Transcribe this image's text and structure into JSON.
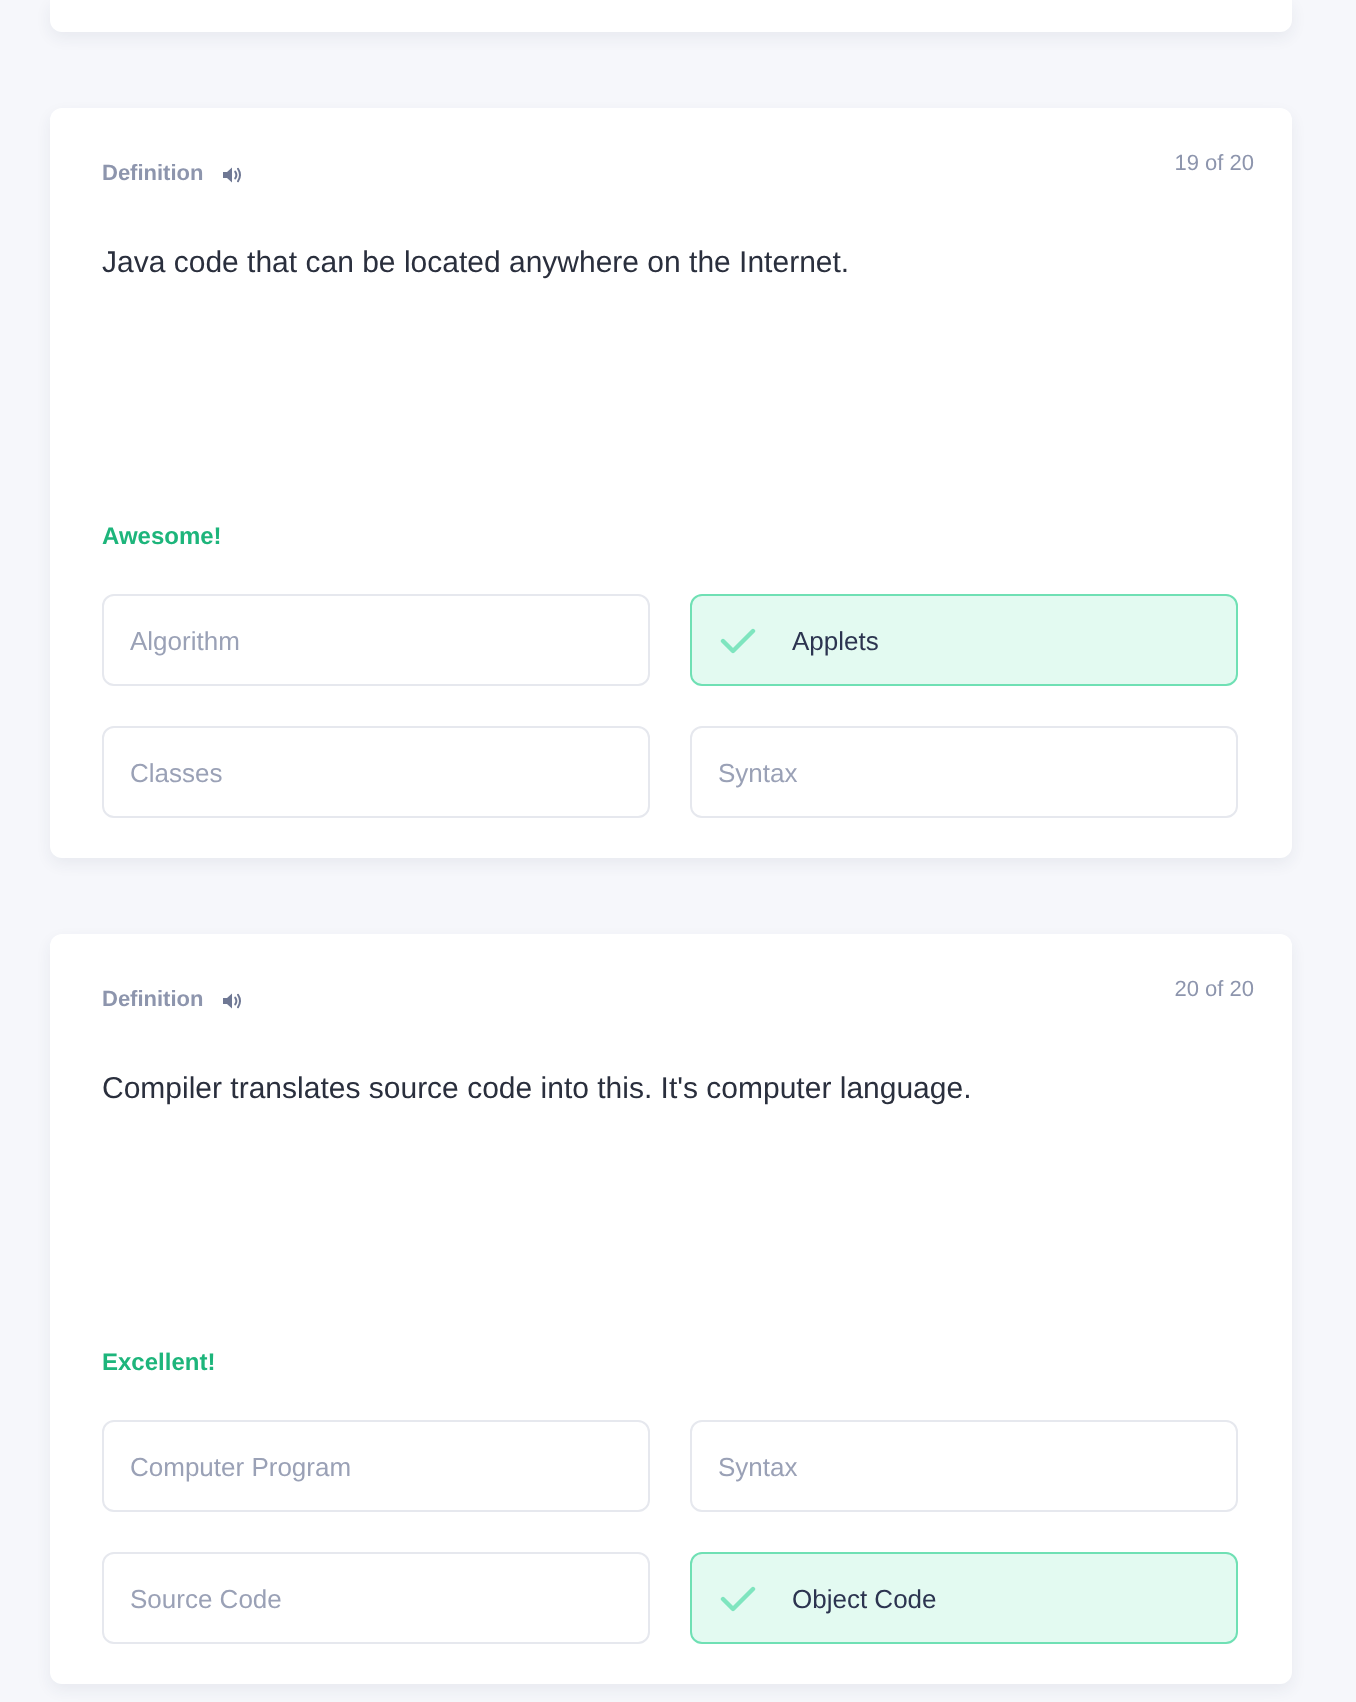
{
  "cards": [
    {
      "label": "Definition",
      "counter": "19 of 20",
      "prompt": "Java code that can be located anywhere on the Internet.",
      "feedback": "Awesome!",
      "options": [
        {
          "text": "Algorithm",
          "selected": false
        },
        {
          "text": "Applets",
          "selected": true
        },
        {
          "text": "Classes",
          "selected": false
        },
        {
          "text": "Syntax",
          "selected": false
        }
      ]
    },
    {
      "label": "Definition",
      "counter": "20 of 20",
      "prompt": "Compiler translates source code into this. It's computer language.",
      "feedback": "Excellent!",
      "options": [
        {
          "text": "Computer Program",
          "selected": false
        },
        {
          "text": "Syntax",
          "selected": false
        },
        {
          "text": "Source Code",
          "selected": false
        },
        {
          "text": "Object Code",
          "selected": true
        }
      ]
    }
  ]
}
